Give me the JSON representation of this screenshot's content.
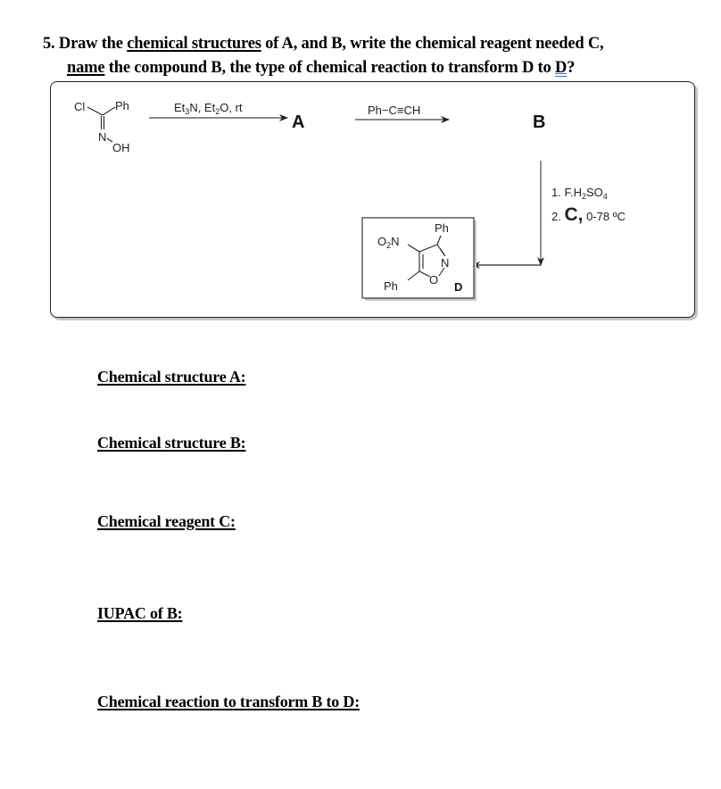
{
  "question": {
    "number": "5.",
    "line1_prefix": " Draw the ",
    "line1_underlined": "chemical structures",
    "line1_suffix": " of A, and B, write the chemical reagent needed C,",
    "line2_underlined": "name",
    "line2_middle": " the compound B, the type of chemical reaction to transform D to ",
    "line2_marked": "D",
    "line2_end": "?"
  },
  "scheme": {
    "start_material": {
      "cl": "Cl",
      "ph": "Ph",
      "n": "N",
      "oh": "OH"
    },
    "step1": {
      "reagents": [
        "Et",
        "3",
        "N, Et",
        "2",
        "O, rt"
      ],
      "product": "A"
    },
    "step2": {
      "reagent": "Ph−C≡CH",
      "product": "B"
    },
    "step3": {
      "condition1": [
        "1. F.H",
        "2",
        "SO",
        "4"
      ],
      "condition2_prefix": "2. ",
      "condition2_reagent": "C,",
      "condition2_temp": " 0-78 ºC"
    },
    "product_d": {
      "o2n": [
        "O",
        "2",
        "N"
      ],
      "ph_top": "Ph",
      "ph_bottom": "Ph",
      "n": "N",
      "o": "O",
      "label": "D"
    }
  },
  "answers": [
    {
      "label": "Chemical structure A:"
    },
    {
      "label": "Chemical structure B:"
    },
    {
      "label": "Chemical reagent C:"
    },
    {
      "label": "IUPAC of B:"
    },
    {
      "label": "Chemical reaction to transform B to D:"
    }
  ]
}
